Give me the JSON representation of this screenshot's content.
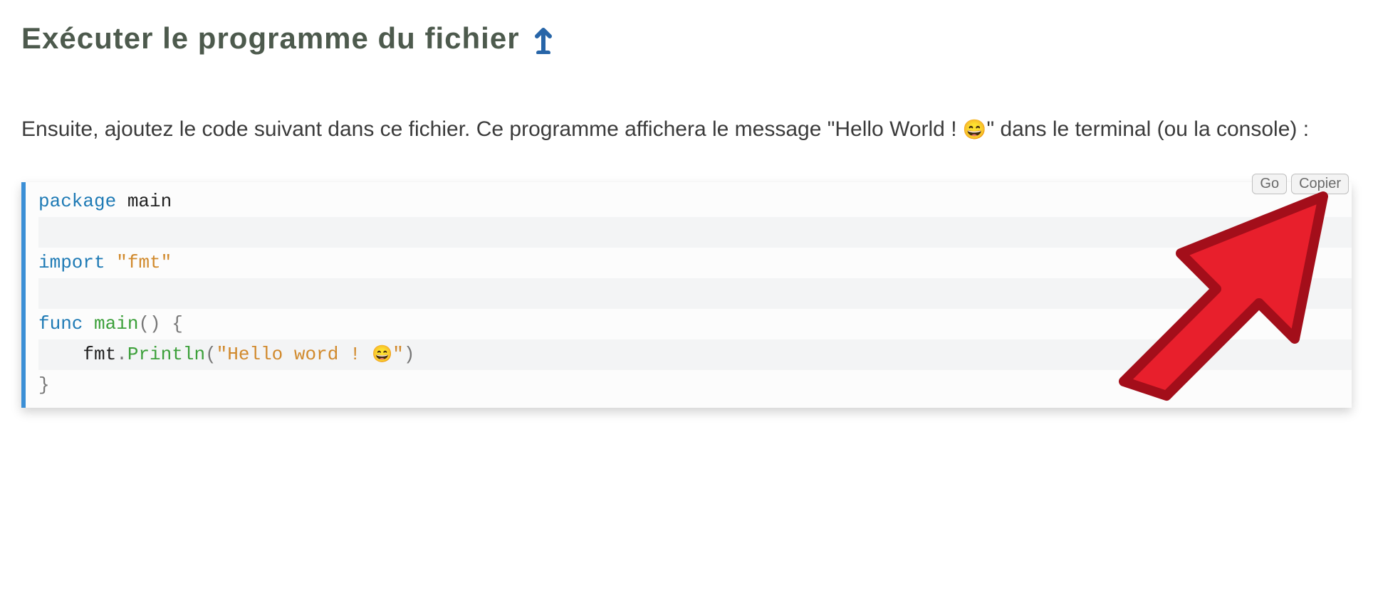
{
  "heading": {
    "text": "Exécuter le programme du fichier"
  },
  "paragraph": {
    "prefix": "Ensuite, ajoutez le code suivant dans ce fichier. Ce programme affichera le message \"Hello World ! ",
    "emoji": "😄",
    "suffix": "\" dans le terminal (ou la console) :"
  },
  "code_badges": {
    "language": "Go",
    "copy": "Copier"
  },
  "code": {
    "line1": {
      "kw": "package",
      "ident": "main"
    },
    "line3": {
      "kw": "import",
      "str": "\"fmt\""
    },
    "line5": {
      "kw": "func",
      "name": "main",
      "parens": "()",
      "brace_open": "{"
    },
    "line6": {
      "indent": "    ",
      "pkg": "fmt",
      "dot": ".",
      "fn": "Println",
      "open": "(",
      "str_prefix": "\"Hello word ! ",
      "emoji": "😄",
      "str_suffix": "\"",
      "close": ")"
    },
    "line7": {
      "brace_close": "}"
    }
  }
}
